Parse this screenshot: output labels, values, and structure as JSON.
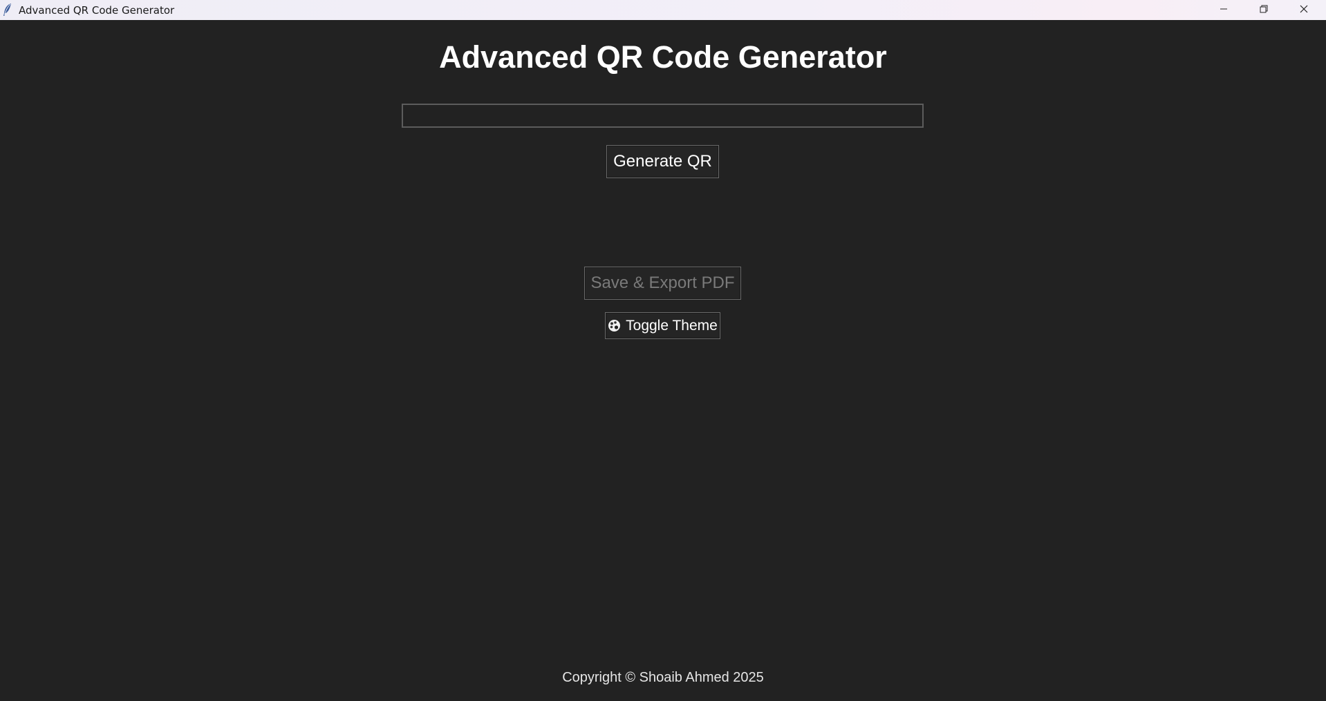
{
  "window": {
    "title": "Advanced QR Code Generator",
    "app_icon": "feather-icon",
    "controls": {
      "minimize_icon": "minimize-icon",
      "maximize_icon": "restore-icon",
      "close_icon": "close-icon"
    }
  },
  "main": {
    "heading": "Advanced QR Code Generator",
    "input": {
      "value": "",
      "placeholder": ""
    },
    "generate_button": "Generate QR",
    "export_button": "Save & Export PDF",
    "theme_button": {
      "icon": "palette-icon",
      "label": "Toggle Theme"
    }
  },
  "footer": {
    "copyright": "Copyright © Shoaib Ahmed 2025"
  },
  "colors": {
    "background": "#222222",
    "text": "#ffffff",
    "disabled_text": "#7a7a7a",
    "border": "#6a6a6a"
  }
}
